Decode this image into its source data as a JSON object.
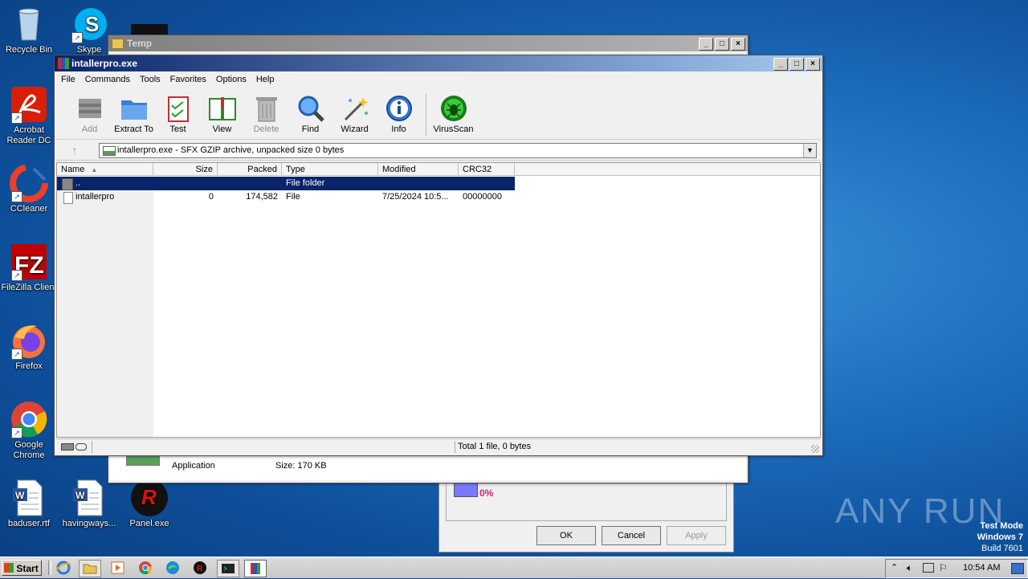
{
  "desktop": {
    "icons": [
      {
        "label": "Recycle Bin"
      },
      {
        "label": "Skype"
      },
      {
        "label": "Acrobat Reader DC"
      },
      {
        "label": "CCleaner"
      },
      {
        "label": "FileZilla Client"
      },
      {
        "label": "Firefox"
      },
      {
        "label": "Google Chrome"
      },
      {
        "label": "baduser.rtf"
      },
      {
        "label": "havingways..."
      },
      {
        "label": "Panel.exe"
      }
    ],
    "watermark": "ANY RUN",
    "test_mode": [
      "Test Mode",
      "Windows 7",
      "Build 7601"
    ]
  },
  "temp_window": {
    "title": "Temp",
    "file_type": "Application",
    "file_size": "Size: 170 KB"
  },
  "props_dialog": {
    "percent": "0%",
    "ok": "OK",
    "cancel": "Cancel",
    "apply": "Apply"
  },
  "winrar": {
    "title": "intallerpro.exe",
    "menu": [
      "File",
      "Commands",
      "Tools",
      "Favorites",
      "Options",
      "Help"
    ],
    "toolbar": [
      {
        "label": "Add",
        "icon": "add-archive-icon",
        "disabled": true
      },
      {
        "label": "Extract To",
        "icon": "extract-folder-icon"
      },
      {
        "label": "Test",
        "icon": "test-clipboard-icon"
      },
      {
        "label": "View",
        "icon": "view-book-icon"
      },
      {
        "label": "Delete",
        "icon": "trash-icon",
        "disabled": true
      },
      {
        "label": "Find",
        "icon": "find-magnifier-icon"
      },
      {
        "label": "Wizard",
        "icon": "wizard-wand-icon"
      },
      {
        "label": "Info",
        "icon": "info-icon"
      },
      {
        "label": "VirusScan",
        "icon": "virus-scan-icon"
      }
    ],
    "address": "intallerpro.exe - SFX GZIP archive, unpacked size 0 bytes",
    "columns": [
      "Name",
      "Size",
      "Packed",
      "Type",
      "Modified",
      "CRC32"
    ],
    "rows": [
      {
        "name": "..",
        "size": "",
        "packed": "",
        "type": "File folder",
        "modified": "",
        "crc": "",
        "selected": true
      },
      {
        "name": "intallerpro",
        "size": "0",
        "packed": "174,582",
        "type": "File",
        "modified": "7/25/2024 10:5...",
        "crc": "00000000",
        "selected": false
      }
    ],
    "status": "Total 1 file, 0 bytes"
  },
  "taskbar": {
    "start": "Start",
    "clock": "10:54 AM"
  }
}
